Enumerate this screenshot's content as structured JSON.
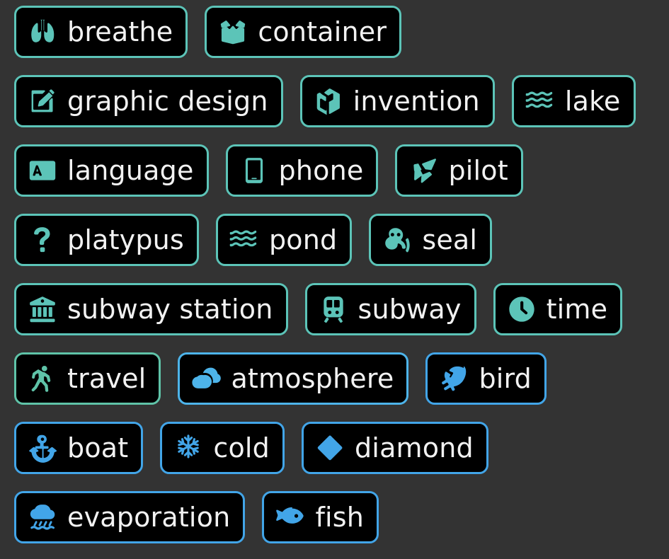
{
  "page": {
    "background_color": "#333333",
    "chip_fill_color": "#000000",
    "label_color": "#f2f2f2"
  },
  "palette": {
    "teal": "#5cc4b8",
    "teal_green": "#5fc3a8",
    "blue": "#42a5e8",
    "light_blue": "#4db4ea"
  },
  "rows": [
    {
      "chips": [
        {
          "label": "breathe",
          "icon": "lungs-icon",
          "color": "#5cc4b8"
        },
        {
          "label": "container",
          "icon": "open-box-icon",
          "color": "#5cc4b8"
        }
      ]
    },
    {
      "chips": [
        {
          "label": "graphic design",
          "icon": "pen-square-icon",
          "color": "#5cc4b8"
        },
        {
          "label": "invention",
          "icon": "cube-icon",
          "color": "#5cc4b8"
        },
        {
          "label": "lake",
          "icon": "waves-icon",
          "color": "#5cc4b8"
        }
      ]
    },
    {
      "chips": [
        {
          "label": "language",
          "icon": "translate-icon",
          "color": "#5cc4b8"
        },
        {
          "label": "phone",
          "icon": "mobile-phone-icon",
          "color": "#5cc4b8"
        },
        {
          "label": "pilot",
          "icon": "paper-plane-icon",
          "color": "#5cc4b8"
        }
      ]
    },
    {
      "chips": [
        {
          "label": "platypus",
          "icon": "question-mark-icon",
          "color": "#5cc4b8"
        },
        {
          "label": "pond",
          "icon": "waves-icon",
          "color": "#5cc4b8"
        },
        {
          "label": "seal",
          "icon": "otter-icon",
          "color": "#5cc4b8"
        }
      ]
    },
    {
      "chips": [
        {
          "label": "subway station",
          "icon": "bank-building-icon",
          "color": "#5cc4b8"
        },
        {
          "label": "subway",
          "icon": "train-icon",
          "color": "#5cc4b8"
        },
        {
          "label": "time",
          "icon": "clock-icon",
          "color": "#5cc4b8"
        }
      ]
    },
    {
      "chips": [
        {
          "label": "travel",
          "icon": "walking-person-icon",
          "color": "#5fc3a8"
        },
        {
          "label": "atmosphere",
          "icon": "cloud-icon",
          "color": "#4db4ea"
        },
        {
          "label": "bird",
          "icon": "feather-icon",
          "color": "#42a5e8"
        }
      ]
    },
    {
      "chips": [
        {
          "label": "boat",
          "icon": "anchor-icon",
          "color": "#42a5e8"
        },
        {
          "label": "cold",
          "icon": "snowflake-icon",
          "color": "#42a5e8"
        },
        {
          "label": "diamond",
          "icon": "diamond-icon",
          "color": "#42a5e8"
        }
      ]
    },
    {
      "chips": [
        {
          "label": "evaporation",
          "icon": "rain-cloud-water-icon",
          "color": "#42a5e8"
        },
        {
          "label": "fish",
          "icon": "fish-icon",
          "color": "#42a5e8"
        }
      ]
    }
  ]
}
